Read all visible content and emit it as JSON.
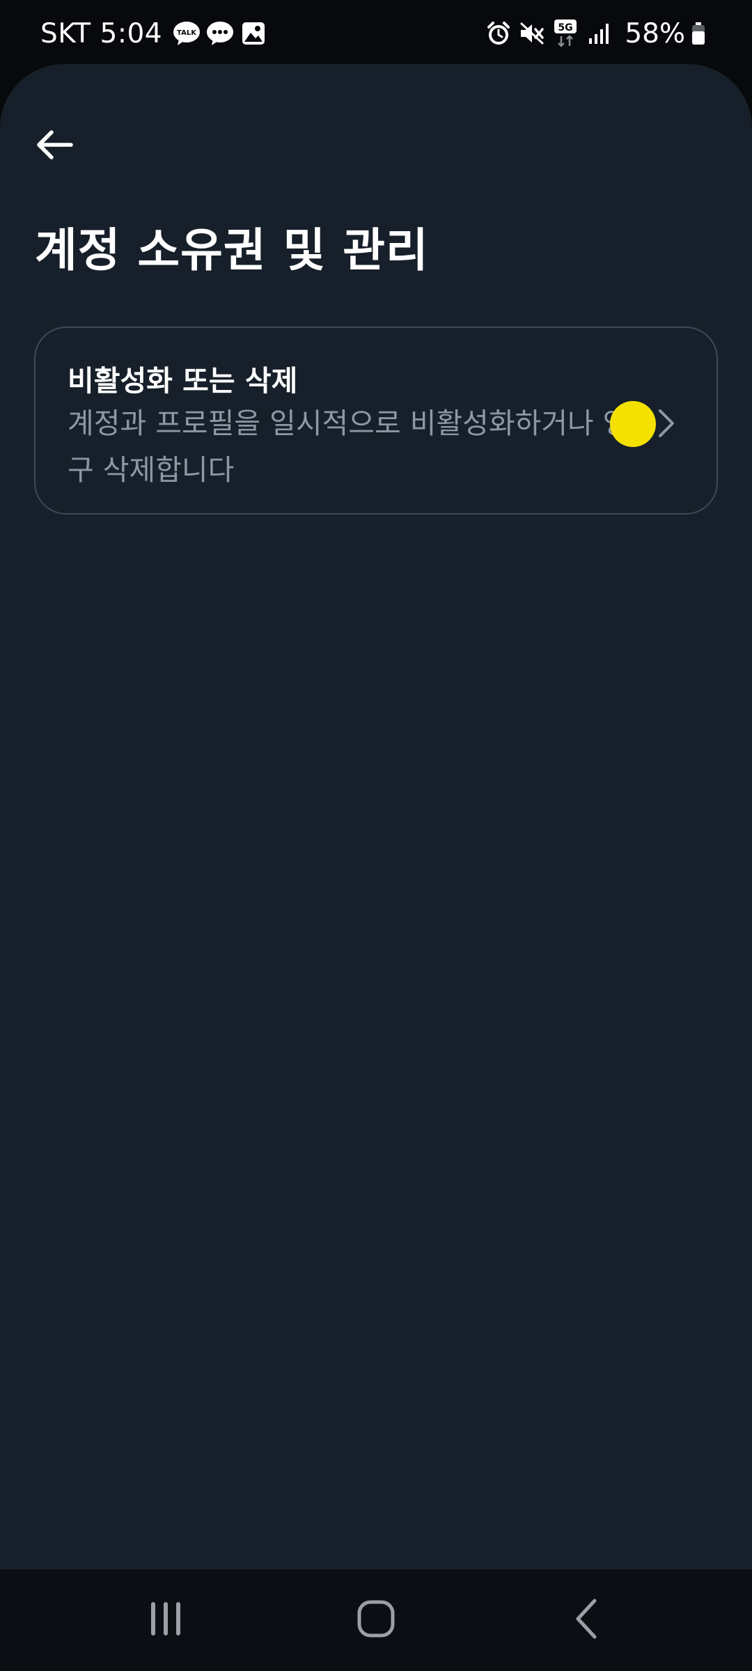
{
  "status_bar": {
    "carrier_time": "SKT 5:04",
    "notification_icons": [
      "kakaotalk-icon",
      "message-icon",
      "gallery-icon"
    ],
    "system_icons": [
      "alarm-icon",
      "mute-icon",
      "5g-icon",
      "signal-icon",
      "battery-icon"
    ],
    "network_label": "5G",
    "talk_label": "TALK",
    "battery_percent": "58%"
  },
  "header": {
    "back_icon": "arrow-left-icon",
    "title": "계정 소유권 및 관리"
  },
  "options": [
    {
      "title": "비활성화 또는 삭제",
      "description": "계정과 프로필을 일시적으로 비활성화하거나 영구 삭제합니다",
      "icon": "chevron-right-icon"
    }
  ],
  "nav_bar": {
    "recents_icon": "recents-icon",
    "home_icon": "home-icon",
    "back_icon": "nav-back-icon"
  },
  "colors": {
    "background": "#17202a",
    "status_bar": "#07090c",
    "card_border": "#3b4a56",
    "secondary_text": "#8c98a4",
    "touch_indicator": "#f5e100"
  }
}
